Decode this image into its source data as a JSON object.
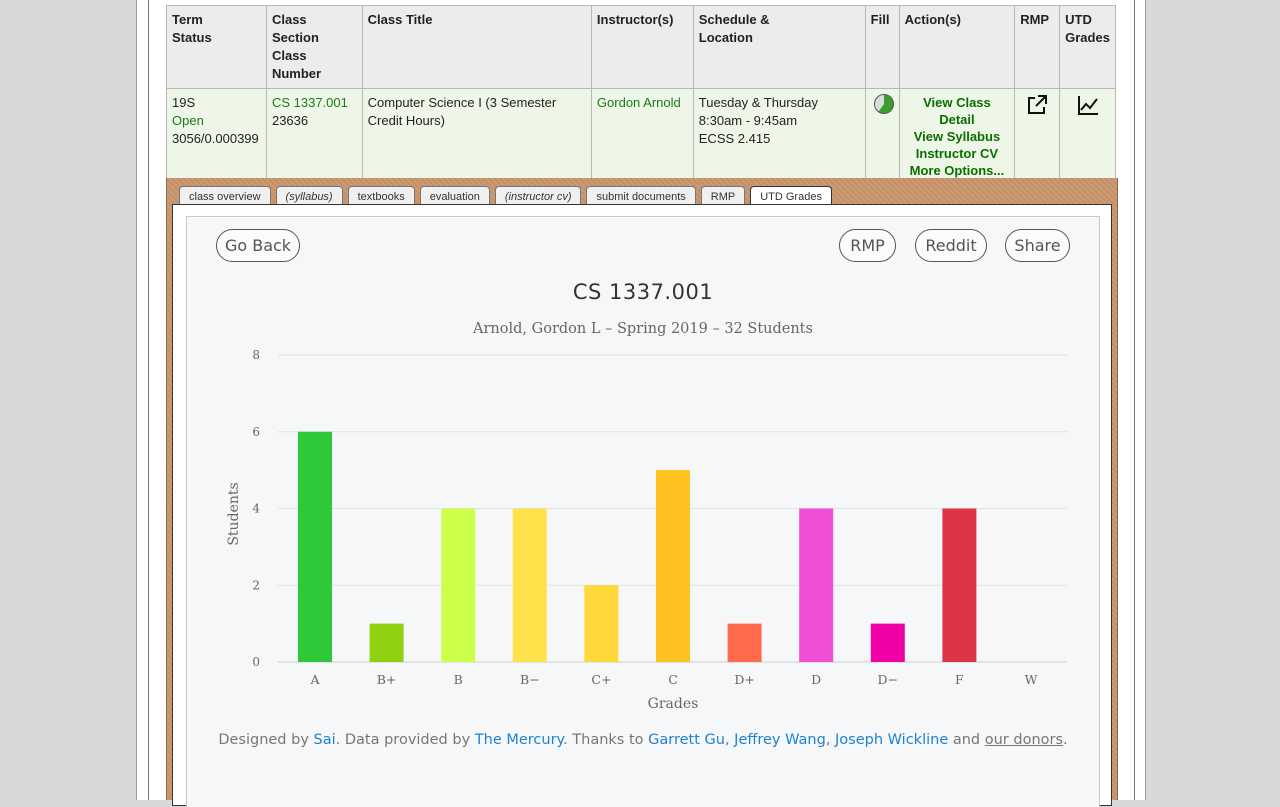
{
  "table": {
    "headers": [
      "Term Status",
      "Class Section Class Number",
      "Class Title",
      "Instructor(s)",
      "Schedule & Location",
      "Fill",
      "Action(s)",
      "RMP",
      "UTD Grades"
    ],
    "header_lines": {
      "term": [
        "Term",
        "Status"
      ],
      "section": [
        "Class",
        "Section",
        "Class",
        "Number"
      ],
      "title": "Class Title",
      "instructor": "Instructor(s)",
      "schedule": [
        "Schedule &",
        "Location"
      ],
      "fill": "Fill",
      "actions": "Action(s)",
      "rmp": "RMP",
      "grades": [
        "UTD",
        "Grades"
      ]
    },
    "row": {
      "term": "19S",
      "status": "Open",
      "term_code": "3056/0.000399",
      "section": "CS 1337.001",
      "class_number": "23636",
      "title": "Computer Science I (3 Semester Credit Hours)",
      "instructor": "Gordon Arnold",
      "days": "Tuesday & Thursday",
      "time": "8:30am - 9:45am",
      "location": "ECSS 2.415",
      "actions": [
        "View Class Detail",
        "View Syllabus",
        "Instructor CV",
        "More Options..."
      ]
    }
  },
  "tabs": [
    {
      "label": "class overview",
      "italic": false
    },
    {
      "label": "(syllabus)",
      "italic": true
    },
    {
      "label": "textbooks",
      "italic": false
    },
    {
      "label": "evaluation",
      "italic": false
    },
    {
      "label": "(instructor cv)",
      "italic": true
    },
    {
      "label": "submit documents",
      "italic": false
    },
    {
      "label": "RMP",
      "italic": false
    },
    {
      "label": "UTD Grades",
      "italic": false,
      "active": true
    }
  ],
  "buttons": {
    "back": "Go Back",
    "rmp": "RMP",
    "reddit": "Reddit",
    "share": "Share"
  },
  "chart_data": {
    "type": "bar",
    "title": "CS 1337.001",
    "subtitle": "Arnold, Gordon L – Spring 2019 – 32 Students",
    "xlabel": "Grades",
    "ylabel": "Students",
    "categories": [
      "A",
      "B+",
      "B",
      "B−",
      "C+",
      "C",
      "D+",
      "D",
      "D−",
      "F",
      "W"
    ],
    "values": [
      6,
      1,
      4,
      4,
      2,
      5,
      1,
      4,
      1,
      4,
      0
    ],
    "colors": [
      "#2ec83a",
      "#8fd10f",
      "#ccff4a",
      "#ffe14c",
      "#ffd83a",
      "#ffc21f",
      "#ff6b4a",
      "#f24dd6",
      "#f000a5",
      "#dc3545",
      "#999999"
    ],
    "ylim": [
      0,
      8
    ],
    "yticks": [
      0,
      2,
      4,
      6,
      8
    ],
    "grid": true,
    "legend": "none"
  },
  "footer": {
    "p1": "Designed by ",
    "sai": "Sai",
    "p2": ". Data provided by ",
    "mercury": "The Mercury",
    "p3": ". Thanks to ",
    "gu": "Garrett Gu",
    "sep1": ", ",
    "wang": "Jeffrey Wang",
    "sep2": ", ",
    "wickline": "Joseph Wickline",
    "p4": " and ",
    "donors": "our donors",
    "p5": "."
  }
}
